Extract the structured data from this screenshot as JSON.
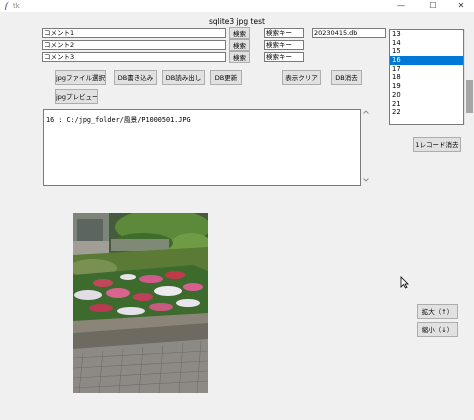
{
  "window": {
    "title": "tk",
    "minimize": "—",
    "maximize": "☐",
    "close": "✕"
  },
  "app_title": "sqlite3 jpg test",
  "comment_fields": [
    "コメント1",
    "コメント2",
    "コメント3"
  ],
  "search_buttons": [
    "検索",
    "検索",
    "検索"
  ],
  "search_key_fields": [
    "検索キー",
    "検索キー",
    "検索キー"
  ],
  "db_file": "20230415.db",
  "records": [
    "13",
    "14",
    "15",
    "16",
    "17",
    "18",
    "19",
    "20",
    "21",
    "22"
  ],
  "selected_record": "16",
  "toolbar": {
    "select_jpg": "jpgファイル選択",
    "db_write": "DB書き込み",
    "db_read": "DB読み出し",
    "db_update": "DB更新",
    "clear_display": "表示クリア",
    "db_delete": "DB消去",
    "jpg_preview": "jpgプレビュー"
  },
  "delete_record": "1レコード消去",
  "text_output": "16 : C:/jpg_folder/風景/P1000501.JPG",
  "zoom_in": "拡大（↑）",
  "zoom_out": "縮小（↓）",
  "colors": {
    "selection": "#0078d7",
    "window_bg": "#f0f0f0",
    "button_bg": "#e1e1e1"
  },
  "icons": [
    "feather-icon",
    "chevron-up-icon",
    "chevron-down-icon",
    "mouse-pointer-icon"
  ]
}
